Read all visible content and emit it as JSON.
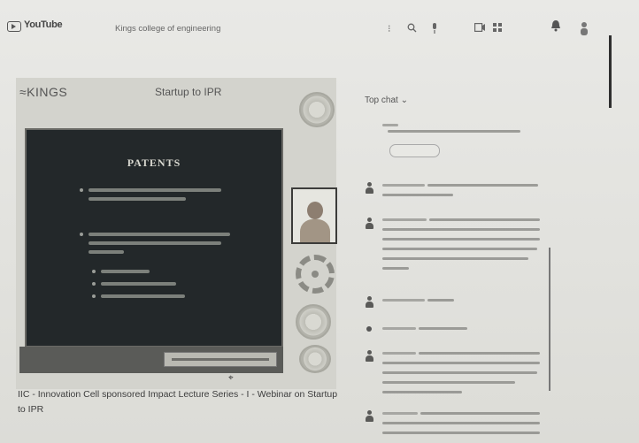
{
  "header": {
    "logo_text": "YouTube",
    "search_text": "Kings college of engineering",
    "icons": [
      "youtube-logo-icon",
      "more-icon",
      "search-icon",
      "mic-icon",
      "create-icon",
      "apps-icon",
      "notifications-icon",
      "avatar-icon"
    ]
  },
  "video": {
    "slide_logo": "≈KINGS",
    "slide_title": "Startup to IPR",
    "panel_heading": "PATENTS",
    "colors": {
      "panel_bg": "#23282a",
      "slide_bg": "#d3d3cd"
    }
  },
  "chat": {
    "header_label": "Top chat ⌄"
  },
  "video_title": "IIC - Innovation Cell sponsored Impact Lecture Series - I - Webinar on Startup to IPR"
}
